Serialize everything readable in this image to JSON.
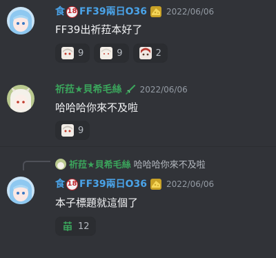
{
  "messages": [
    {
      "author": "FF39兩日O36",
      "prefix": "食",
      "badge": "18",
      "timestamp": "2022/06/06",
      "text": "FF39出祈菈本好了",
      "reactions": [
        {
          "count": "9"
        },
        {
          "count": "9"
        },
        {
          "count": "2"
        }
      ]
    },
    {
      "author": "祈菈★貝希毛絲",
      "timestamp": "2022/06/06",
      "text": "哈哈哈你來不及啦",
      "reactions": [
        {
          "count": "9"
        }
      ]
    },
    {
      "reply": {
        "author": "祈菈★貝希毛絲",
        "text": "哈哈哈你來不及啦"
      },
      "author": "FF39兩日O36",
      "prefix": "食",
      "badge": "18",
      "timestamp": "2022/06/06",
      "text": "本子標題就這個了",
      "reactions": [
        {
          "count": "12"
        }
      ]
    }
  ],
  "colors": {
    "background": "#313338",
    "blue_name": "#4aa3e8",
    "green_name": "#3ba55c"
  },
  "icons": [
    "avatar-blue-hair",
    "avatar-white-hair",
    "cheese-icon",
    "sword-icon",
    "badge-18-icon"
  ]
}
